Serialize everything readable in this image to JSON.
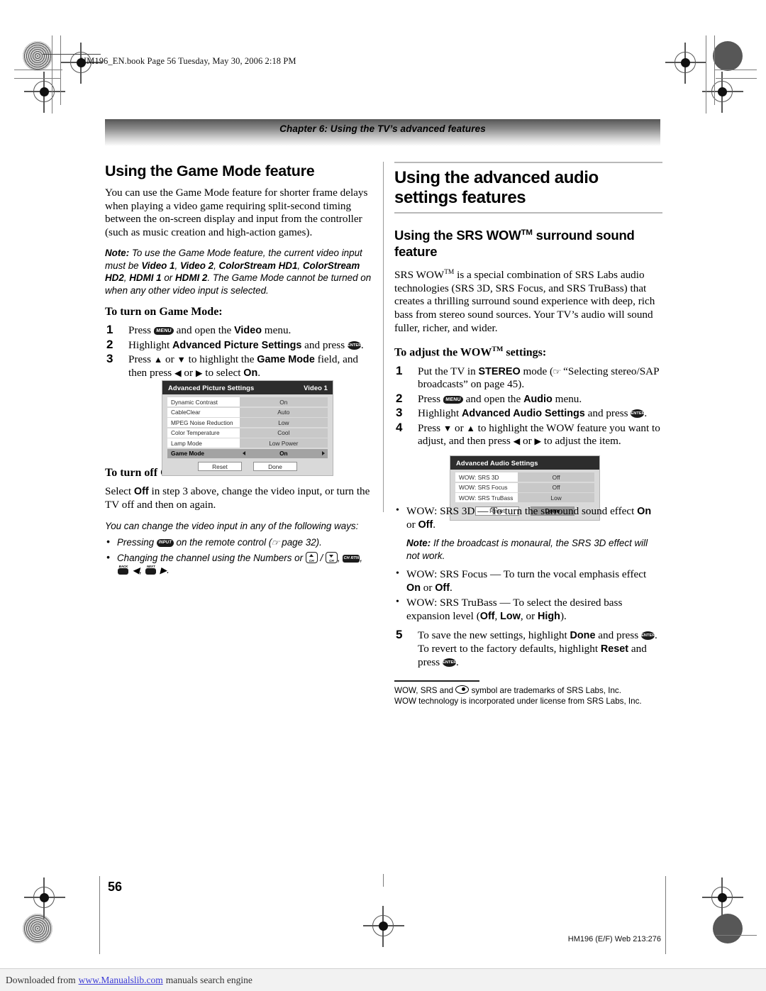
{
  "file_header": "HM196_EN.book  Page 56  Tuesday, May 30, 2006  2:18 PM",
  "chapter_bar": "Chapter 6: Using the TV’s advanced features",
  "left_column": {
    "section_title": "Using the Game Mode feature",
    "intro": "You can use the Game Mode feature for shorter frame delays when playing a video game requiring split-second timing between the on-screen display and input from the controller (such as music creation and high-action games).",
    "note_label": "Note:",
    "note_p1": " To use the Game Mode feature, the current video input must be ",
    "note_b1": "Video 1",
    "note_sep1": ", ",
    "note_b2": "Video 2",
    "note_sep2": ", ",
    "note_b3": "ColorStream HD1",
    "note_sep3": ", ",
    "note_b4": "ColorStream HD2",
    "note_sep4": ", ",
    "note_b5": "HDMI 1",
    "note_sep5": " or ",
    "note_b6": "HDMI 2",
    "note_p2": ". The Game Mode cannot be turned on when any other video input is selected.",
    "turn_on_head": "To turn on Game Mode:",
    "step1_a": "Press ",
    "step1_b": " and open the ",
    "step1_bold": "Video",
    "step1_c": " menu.",
    "step2_a": "Highlight ",
    "step2_bold": "Advanced Picture Settings",
    "step2_b": " and press ",
    "step2_c": ".",
    "step3_a": "Press ",
    "step3_b": " or ",
    "step3_c": " to highlight the ",
    "step3_bold": "Game Mode",
    "step3_d": " field, and then press ",
    "step3_e": " or ",
    "step3_f": " to select ",
    "step3_bold2": "On",
    "step3_g": ".",
    "turn_off_head": "To turn off Game Mode:",
    "turn_off_a": "Select ",
    "turn_off_bold": "Off",
    "turn_off_b": " in step 3 above, change the video input, or turn the TV off and then on again.",
    "ways_intro": "You can change the video input in any of the following ways:",
    "bullet1_a": "Pressing ",
    "bullet1_b": " on the remote control (",
    "bullet1_c": " page 32).",
    "bullet2_a": "Changing the channel using the Numbers or ",
    "bullet2_b": " / ",
    "bullet2_c": ", ",
    "bullet2_d": ", "
  },
  "osd_picture": {
    "title": "Advanced Picture Settings",
    "input": "Video 1",
    "rows": [
      {
        "label": "Dynamic Contrast",
        "value": "On",
        "selected": false
      },
      {
        "label": "CableClear",
        "value": "Auto",
        "selected": false
      },
      {
        "label": "MPEG Noise Reduction",
        "value": "Low",
        "selected": false
      },
      {
        "label": "Color Temperature",
        "value": "Cool",
        "selected": false
      },
      {
        "label": "Lamp Mode",
        "value": "Low Power",
        "selected": false
      },
      {
        "label": "Game Mode",
        "value": "On",
        "selected": true
      }
    ],
    "reset_label": "Reset",
    "done_label": "Done"
  },
  "osd_audio": {
    "title": "Advanced Audio Settings",
    "input": "",
    "rows": [
      {
        "label": "WOW: SRS 3D",
        "value": "Off",
        "selected": false
      },
      {
        "label": "WOW: SRS Focus",
        "value": "Off",
        "selected": false
      },
      {
        "label": "WOW: SRS TruBass",
        "value": "Low",
        "selected": false
      }
    ],
    "reset_label": "Reset",
    "done_label": "Done"
  },
  "right_column": {
    "main_title": "Using the advanced audio settings features",
    "sub_title_a": "Using the SRS WOW",
    "sub_title_tm": "TM",
    "sub_title_b": " surround sound feature",
    "intro_a": "SRS WOW",
    "intro_tm": "TM",
    "intro_b": " is a special combination of SRS Labs audio technologies (SRS 3D, SRS Focus, and SRS TruBass) that creates a thrilling surround sound experience with deep, rich bass from stereo sound sources. Your TV’s audio will sound fuller, richer, and wider.",
    "adjust_head_a": "To adjust the WOW",
    "adjust_head_tm": "TM",
    "adjust_head_b": " settings:",
    "step1_a": "Put the TV in ",
    "step1_bold": "STEREO",
    "step1_b": " mode (",
    "step1_c": " “Selecting stereo/SAP broadcasts” on page 45).",
    "step2_a": "Press ",
    "step2_b": " and open the ",
    "step2_bold": "Audio",
    "step2_c": " menu.",
    "step3_a": "Highlight ",
    "step3_bold": "Advanced Audio Settings",
    "step3_b": " and press ",
    "step3_c": ".",
    "step4_a": "Press ",
    "step4_b": " or ",
    "step4_c": " to highlight the WOW feature you want to adjust, and then press ",
    "step4_d": " or ",
    "step4_e": " to adjust the item.",
    "bullet1_a": "WOW: SRS 3D — To turn the surround sound effect ",
    "bullet1_bold1": "On",
    "bullet1_b": " or ",
    "bullet1_bold2": "Off",
    "bullet1_c": ".",
    "bullet_note_label": "Note:",
    "bullet_note_text": " If the broadcast is monaural, the SRS 3D effect will not work.",
    "bullet2_a": "WOW: SRS Focus — To turn the vocal emphasis effect ",
    "bullet2_bold1": "On",
    "bullet2_b": " or ",
    "bullet2_bold2": "Off",
    "bullet2_c": ".",
    "bullet3_a": "WOW: SRS TruBass — To select the desired bass expansion level (",
    "bullet3_bold1": "Off",
    "bullet3_b": ", ",
    "bullet3_bold2": "Low",
    "bullet3_c": ", or ",
    "bullet3_bold3": "High",
    "bullet3_d": ").",
    "step5_a": "To save the new settings, highlight ",
    "step5_bold1": "Done",
    "step5_b": " and press ",
    "step5_c": ". To revert to the factory defaults, highlight ",
    "step5_bold2": "Reset",
    "step5_d": " and press ",
    "step5_e": ".",
    "footnote_line1_a": "WOW, SRS and ",
    "footnote_line1_b": " symbol are trademarks of SRS Labs, Inc.",
    "footnote_line2": "WOW technology is incorporated under license from SRS Labs, Inc."
  },
  "page_number": "56",
  "page_footer": "HM196 (E/F) Web 213:276",
  "bottom_bar": {
    "prefix": "Downloaded from",
    "link": "www.Manualslib.com",
    "suffix": "manuals search engine"
  },
  "glyphs": {
    "menu": "MENU",
    "enter": "ENTER",
    "input": "INPUT",
    "ch_ret": "CH RTN",
    "ch_up": "CH",
    "ch_down": "CH",
    "skip_back": "BACK",
    "skip_next": "NEXT",
    "hand_pointer": "☞",
    "arrow_up": "▲",
    "arrow_down": "▼",
    "arrow_left": "◀",
    "arrow_right": "▶"
  },
  "colors": {
    "link": "#3b3bd6",
    "osd_title_bg": "#2d2d2d",
    "osd_bg": "#d9d9d9",
    "rule": "#b9b9b9"
  }
}
